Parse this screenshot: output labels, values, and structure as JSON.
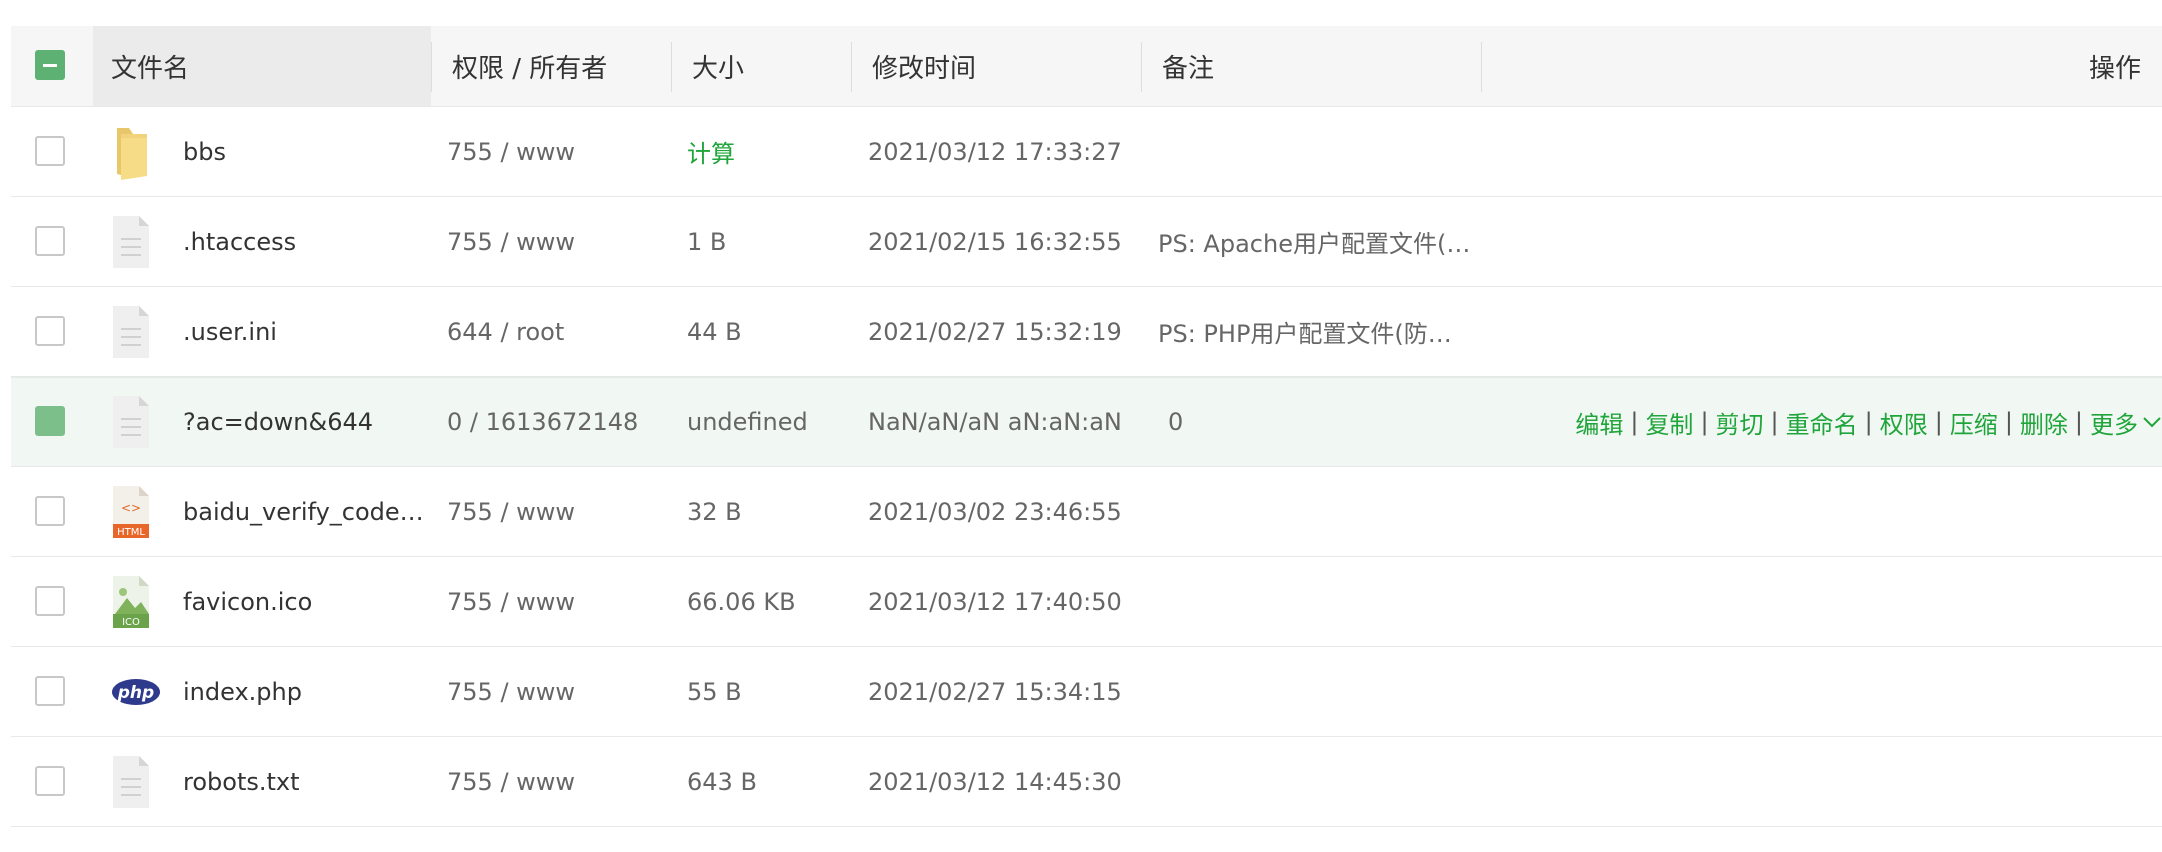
{
  "header": {
    "name": "文件名",
    "perm": "权限 / 所有者",
    "size": "大小",
    "mtime": "修改时间",
    "note": "备注",
    "ops": "操作"
  },
  "rows": [
    {
      "name": "bbs",
      "perm": "755 / www",
      "size": "计算",
      "mtime": "2021/03/12 17:33:27",
      "note": "",
      "icon": "folder-icon"
    },
    {
      "name": ".htaccess",
      "perm": "755 / www",
      "size": "1 B",
      "mtime": "2021/02/15 16:32:55",
      "note": "PS: Apache用户配置文件(…",
      "icon": "file-icon"
    },
    {
      "name": ".user.ini",
      "perm": "644 / root",
      "size": "44 B",
      "mtime": "2021/02/27 15:32:19",
      "note": "PS: PHP用户配置文件(防…",
      "icon": "file-icon"
    },
    {
      "name": "?ac=down&644",
      "perm": "0 / 1613672148",
      "size": "undefined",
      "mtime": "NaN/aN/aN aN:aN:aN",
      "note": "0",
      "icon": "file-icon"
    },
    {
      "name": "baidu_verify_code-…",
      "perm": "755 / www",
      "size": "32 B",
      "mtime": "2021/03/02 23:46:55",
      "note": "",
      "icon": "html-file-icon"
    },
    {
      "name": "favicon.ico",
      "perm": "755 / www",
      "size": "66.06 KB",
      "mtime": "2021/03/12 17:40:50",
      "note": "",
      "icon": "image-file-icon"
    },
    {
      "name": "index.php",
      "perm": "755 / www",
      "size": "55 B",
      "mtime": "2021/02/27 15:34:15",
      "note": "",
      "icon": "php-file-icon"
    },
    {
      "name": "robots.txt",
      "perm": "755 / www",
      "size": "643 B",
      "mtime": "2021/03/12 14:45:30",
      "note": "",
      "icon": "file-icon"
    }
  ],
  "actions": {
    "edit": "编辑",
    "copy": "复制",
    "cut": "剪切",
    "rename": "重命名",
    "perm": "权限",
    "compress": "压缩",
    "delete": "删除",
    "more": "更多",
    "separator": "|"
  },
  "icon_labels": {
    "html": "HTML",
    "ico": "ICO",
    "php": "php",
    "code": "<>"
  },
  "colors": {
    "accent": "#20a53a",
    "selected_row": "#f1f8f4",
    "checkbox_green": "#7dbf8b"
  }
}
